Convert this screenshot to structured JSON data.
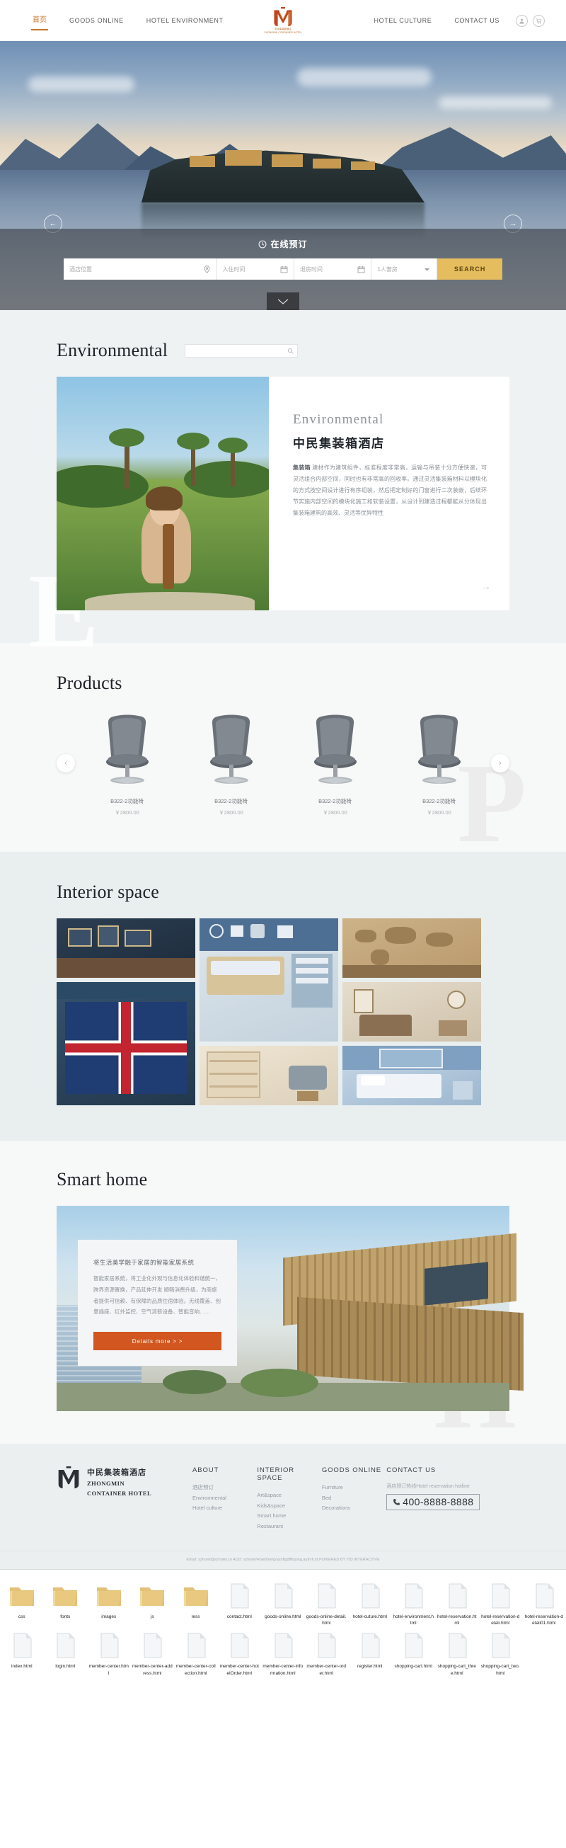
{
  "nav": {
    "items_left": [
      {
        "label": "首页",
        "active": true,
        "cn": true
      },
      {
        "label": "GOODS ONLINE",
        "active": false,
        "cn": false
      },
      {
        "label": "HOTEL ENVIRONMENT",
        "active": false,
        "cn": false
      }
    ],
    "items_right": [
      {
        "label": "HOTEL CULTURE",
        "active": false
      },
      {
        "label": "CONTACT US",
        "active": false
      }
    ],
    "logo_caption": "中民集装箱酒店",
    "logo_caption_en": "ZHONGMIN CONTAINER HOTEL",
    "icons": [
      {
        "name": "user-icon"
      },
      {
        "name": "cart-icon"
      }
    ]
  },
  "hero": {
    "prev_label": "←",
    "next_label": "→",
    "scroll_hint": "scroll-down"
  },
  "booking": {
    "title": "在线预订",
    "fields": [
      {
        "name": "location",
        "placeholder": "酒店位置",
        "icon": "map-pin-icon"
      },
      {
        "name": "checkin",
        "placeholder": "入住时间",
        "icon": "calendar-icon"
      },
      {
        "name": "checkout",
        "placeholder": "退房时间",
        "icon": "calendar-icon"
      },
      {
        "name": "guests",
        "placeholder": "1人套房",
        "icon": "chevron-down-icon"
      }
    ],
    "search_label": "SEARCH"
  },
  "environmental": {
    "title": "Environmental",
    "search_placeholder": "",
    "eyebrow": "Environmental",
    "heading": "中民集装箱酒店",
    "body_lead": "集装箱",
    "body": "建材作为建筑组件，标准程度非常高，运输与吊装十分方便快速，可灵活组合内部空间，同时也有非常高的回收率。通过灵活集装箱材料以模块化的方式按空间设计进行有序组装，然后把定制好的门窗进行二次装嵌，后续环节实施内部空间的模块化施工和软装设置，从设计到建造过程都能从分体现出集装箱建筑的高效、灵活等优异特性",
    "more_label": "→"
  },
  "products": {
    "title": "Products",
    "prev_label": "‹",
    "next_label": "›",
    "items": [
      {
        "name": "B322-2功能椅",
        "price": "￥2800.00"
      },
      {
        "name": "B322-2功能椅",
        "price": "￥2800.00"
      },
      {
        "name": "B322-2功能椅",
        "price": "￥2800.00"
      },
      {
        "name": "B322-2功能椅",
        "price": "￥2800.00"
      }
    ],
    "ghost": "P"
  },
  "interior": {
    "title": "Interior space",
    "tiles": [
      {
        "name": "gallery-wall-room"
      },
      {
        "name": "union-jack-bedroom"
      },
      {
        "name": "kids-bunk-room"
      },
      {
        "name": "study-bookshelf-room"
      },
      {
        "name": "world-map-wall"
      },
      {
        "name": "classic-sitting-room"
      },
      {
        "name": "blue-single-bedroom"
      }
    ]
  },
  "smart": {
    "title": "Smart home",
    "heading": "将生活美学融于家居的智能家居系统",
    "body": "智能家居系统，将工业化外观与信息化体验和谐统一，跨界资源置换，产品延伸开发 顺畅消费升级，为商旅者提供可信赖、有保障的品质住宿体验。无线覆盖、创意插座、红外监控、空气清新设备、智能音响……",
    "button_label": "Details more > >",
    "ghost": "H"
  },
  "footer": {
    "brand_cn": "中民集装箱酒店",
    "brand_en_line1": "ZHONGMIN",
    "brand_en_line2": "CONTAINER HOTEL",
    "columns": [
      {
        "heading": "ABOUT",
        "links": [
          "酒店预订",
          "Environmental",
          "Hotel culture"
        ]
      },
      {
        "heading": "INTERIOR SPACE",
        "links": [
          "Art&space",
          "Kids&space",
          "Smart home",
          "Restaurant"
        ]
      },
      {
        "heading": "GOODS ONLINE",
        "links": [
          "Furniture",
          "Bed",
          "Decorations"
        ]
      }
    ],
    "contact_heading": "CONTACT US",
    "hotline_label": "酒店预订热线Hotel reservation hotline",
    "hotline_number": "400-8888-8888",
    "copyright": "Email: szhotel@szhotel.cn  ADD: szhotel/Hotel/bei/g/ay/dfgdfff/gong.auth/h.id POWERED BY YID INTERACTIVE"
  },
  "files": {
    "row1": [
      {
        "label": "css",
        "type": "folder"
      },
      {
        "label": "fonts",
        "type": "folder"
      },
      {
        "label": "images",
        "type": "folder"
      },
      {
        "label": "js",
        "type": "folder"
      },
      {
        "label": "less",
        "type": "folder"
      },
      {
        "label": "contact.html",
        "type": "file"
      },
      {
        "label": "goods-online.html",
        "type": "file"
      },
      {
        "label": "goods-online-detail.html",
        "type": "file"
      },
      {
        "label": "hotel-cuture.html",
        "type": "file"
      },
      {
        "label": "hotel-environment.html",
        "type": "file"
      },
      {
        "label": "hotel-reservation.html",
        "type": "file"
      },
      {
        "label": "hotel-reservation-detali.html",
        "type": "file"
      },
      {
        "label": "hotel-reservation-detali01.html",
        "type": "file"
      }
    ],
    "row2": [
      {
        "label": "index.html",
        "type": "file"
      },
      {
        "label": "login.html",
        "type": "file"
      },
      {
        "label": "member-center.html",
        "type": "file"
      },
      {
        "label": "member-center-address.html",
        "type": "file"
      },
      {
        "label": "member-center-collection.html",
        "type": "file"
      },
      {
        "label": "member-center-hotelOrder.html",
        "type": "file"
      },
      {
        "label": "member-center-information.html",
        "type": "file"
      },
      {
        "label": "member-center-order.html",
        "type": "file"
      },
      {
        "label": "register.html",
        "type": "file"
      },
      {
        "label": "shopping-cart.html",
        "type": "file"
      },
      {
        "label": "shopping-cart_three.html",
        "type": "file"
      },
      {
        "label": "shopping-cart_two.html",
        "type": "file"
      }
    ]
  },
  "colors": {
    "accent_orange": "#c8762a",
    "logo_red": "#c0451f",
    "search_gold": "#e5bd5e",
    "button_orange": "#d2561f"
  }
}
